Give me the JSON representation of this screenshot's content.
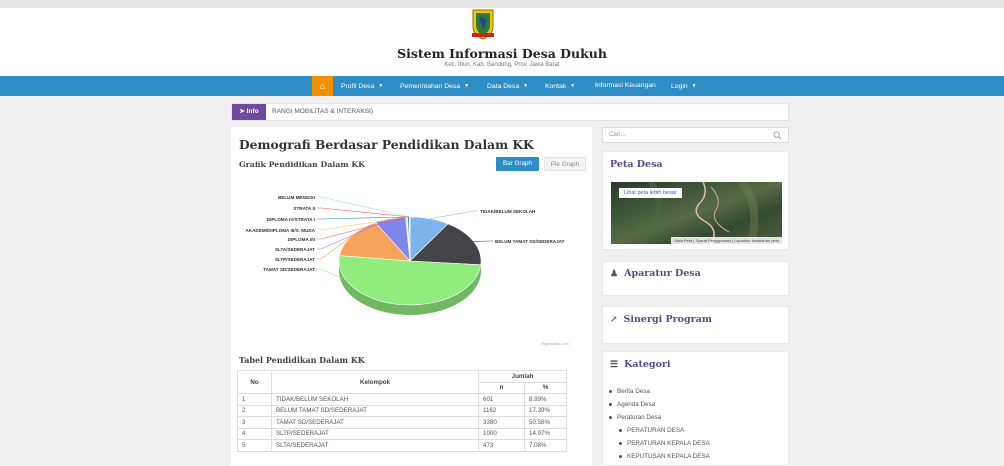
{
  "site": {
    "title": "Sistem Informasi Desa Dukuh",
    "subtitle": "Kec. Ibun, Kab. Bandung, Prov. Jawa Barat"
  },
  "nav": {
    "home_icon": "home-icon",
    "items": [
      {
        "label": "Profil Desa",
        "dropdown": true
      },
      {
        "label": "Pemerintahan Desa",
        "dropdown": true
      },
      {
        "label": "Data Desa",
        "dropdown": true
      },
      {
        "label": "Kontak",
        "dropdown": true
      },
      {
        "label": "Informasi Keuangan",
        "dropdown": false
      },
      {
        "label": "Login",
        "dropdown": true
      }
    ]
  },
  "info": {
    "badge": "Info",
    "text": "RANGI MOBILITAS & INTERAKSI)"
  },
  "main": {
    "title": "Demografi Berdasar Pendidikan Dalam KK",
    "chart_title": "Grafik Pendidikan Dalam KK",
    "btn_bar": "Bar Graph",
    "btn_pie": "Pie Graph",
    "credit": "Highcharts.com",
    "table_title": "Tabel Pendidikan Dalam KK"
  },
  "chart_data": {
    "type": "pie",
    "series": [
      {
        "name": "TIDAK/BELUM SEKOLAH",
        "value": 8.99,
        "color": "#7cb5ec"
      },
      {
        "name": "BELUM TAMAT SD/SEDERAJAT",
        "value": 17.39,
        "color": "#434348"
      },
      {
        "name": "TAMAT SD/SEDERAJAT",
        "value": 50.58,
        "color": "#90ed7d"
      },
      {
        "name": "SLTP/SEDERAJAT",
        "value": 14.97,
        "color": "#f7a35c"
      },
      {
        "name": "SLTA/SEDERAJAT",
        "value": 7.08,
        "color": "#8085e9"
      },
      {
        "name": "DIPLOMA I/II",
        "value": 0.2,
        "color": "#f15c80"
      },
      {
        "name": "AKADEMI/DIPLOMA III/S. MUDA",
        "value": 0.25,
        "color": "#e4d354"
      },
      {
        "name": "DIPLOMA IV/STRATA I",
        "value": 0.4,
        "color": "#2b908f"
      },
      {
        "name": "STRATA II",
        "value": 0.08,
        "color": "#f45b5b"
      },
      {
        "name": "BELUM MENGISI",
        "value": 0.06,
        "color": "#91e8e1"
      }
    ]
  },
  "table": {
    "headers": {
      "no": "No",
      "kelompok": "Kelompok",
      "jumlah": "Jumlah",
      "n": "n",
      "pct": "%"
    },
    "rows": [
      {
        "no": "1",
        "kelompok": "TIDAK/BELUM SEKOLAH",
        "n": "601",
        "pct": "8.99%"
      },
      {
        "no": "2",
        "kelompok": "BELUM TAMAT SD/SEDERAJAT",
        "n": "1162",
        "pct": "17.39%"
      },
      {
        "no": "3",
        "kelompok": "TAMAT SD/SEDERAJAT",
        "n": "3380",
        "pct": "50.58%"
      },
      {
        "no": "4",
        "kelompok": "SLTP/SEDERAJAT",
        "n": "1000",
        "pct": "14.97%"
      },
      {
        "no": "5",
        "kelompok": "SLTA/SEDERAJAT",
        "n": "473",
        "pct": "7.08%"
      }
    ]
  },
  "sidebar": {
    "search_placeholder": "Cari...",
    "peta_title": "Peta Desa",
    "map_link": "Lihat peta lebih besar",
    "map_footer": "Data Peta | Syarat Penggunaan | Laporkan kesalahan peta",
    "aparatur_title": "Aparatur Desa",
    "sinergi_title": "Sinergi Program",
    "kategori_title": "Kategori",
    "kategori_items": [
      {
        "label": "Berita Desa",
        "sub": false
      },
      {
        "label": "Agenda Desa",
        "sub": false
      },
      {
        "label": "Peraturan Desa",
        "sub": false
      },
      {
        "label": "PERATURAN DESA",
        "sub": true
      },
      {
        "label": "PERATURAN KEPALA DESA",
        "sub": true
      },
      {
        "label": "KEPUTUSAN KEPALA DESA",
        "sub": true
      }
    ]
  }
}
